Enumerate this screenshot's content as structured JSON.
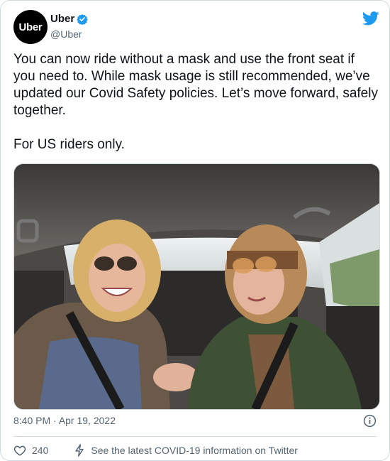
{
  "account": {
    "avatar_text": "Uber",
    "name": "Uber",
    "handle": "@Uber"
  },
  "tweet": {
    "paragraph_1": "You can now ride without a mask and use the front seat if you need to. While mask usage is still recommended, we’ve updated our Covid Safety policies. Let’s move forward, safely together.",
    "paragraph_2": "For US riders only."
  },
  "meta": {
    "time": "8:40 PM",
    "separator": " · ",
    "date": "Apr 19, 2022"
  },
  "actions": {
    "likes": "240",
    "covid_link": "See the latest COVID-19 information on Twitter"
  },
  "colors": {
    "twitter_blue": "#1d9bf0",
    "secondary_text": "#536471",
    "like_icon": "#536471"
  },
  "icons": [
    "verified-badge-icon",
    "twitter-bird-icon",
    "info-icon",
    "heart-icon",
    "lightning-icon"
  ]
}
